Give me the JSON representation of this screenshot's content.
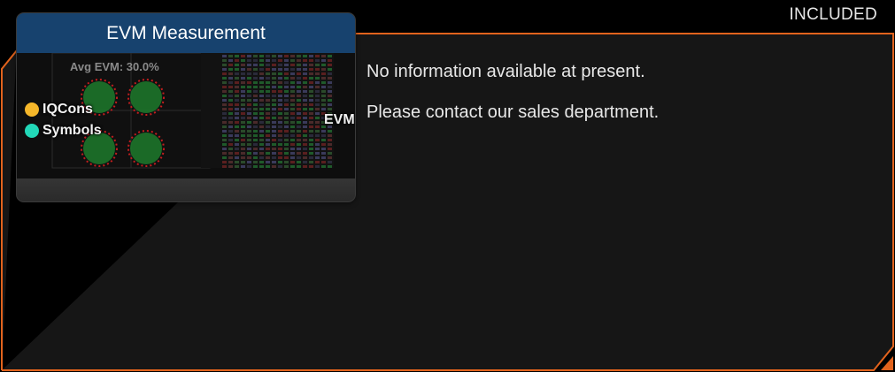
{
  "panel": {
    "status_label": "INCLUDED",
    "border_color": "#e2631d",
    "info_lines": [
      "No information available at present.",
      "Please contact our sales department."
    ]
  },
  "node": {
    "title": "EVM Measurement",
    "preview_caption": "Avg EVM: 30.0%",
    "title_bg": "#17426e",
    "inputs": [
      {
        "label": "IQCons",
        "color": "#f5b72a"
      },
      {
        "label": "Symbols",
        "color": "#22d8b8"
      }
    ],
    "outputs": [
      {
        "label": "EVM",
        "color": "#b8191b"
      }
    ]
  }
}
